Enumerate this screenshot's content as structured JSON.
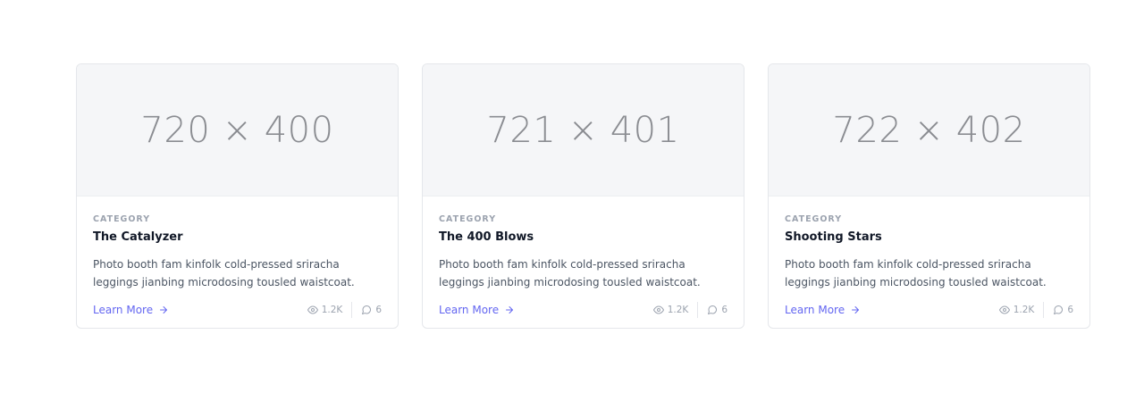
{
  "cards": [
    {
      "image_label": "720 × 400",
      "category": "CATEGORY",
      "title": "The Catalyzer",
      "description": "Photo booth fam kinfolk cold-pressed sriracha leggings jianbing microdosing tousled waistcoat.",
      "link_label": "Learn More",
      "views": "1.2K",
      "comments": "6"
    },
    {
      "image_label": "721 × 401",
      "category": "CATEGORY",
      "title": "The 400 Blows",
      "description": "Photo booth fam kinfolk cold-pressed sriracha leggings jianbing microdosing tousled waistcoat.",
      "link_label": "Learn More",
      "views": "1.2K",
      "comments": "6"
    },
    {
      "image_label": "722 × 402",
      "category": "CATEGORY",
      "title": "Shooting Stars",
      "description": "Photo booth fam kinfolk cold-pressed sriracha leggings jianbing microdosing tousled waistcoat.",
      "link_label": "Learn More",
      "views": "1.2K",
      "comments": "6"
    }
  ],
  "colors": {
    "accent": "#6366f1",
    "muted": "#9ca3af",
    "image_bg": "#f5f6f8"
  },
  "icons": {
    "link": "arrow-right-icon",
    "views": "eye-icon",
    "comments": "comment-icon"
  }
}
